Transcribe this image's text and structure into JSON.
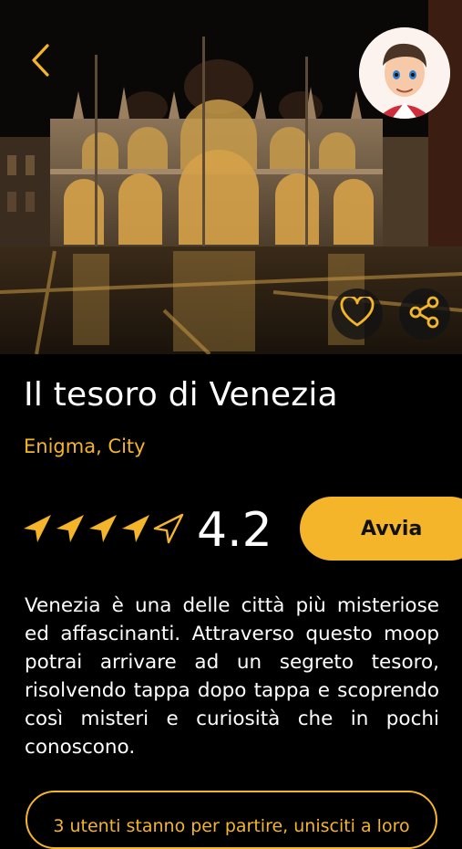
{
  "header": {
    "back_icon": "chevron-left-icon",
    "avatar_icon": "user-avatar"
  },
  "hero": {
    "favorite_icon": "heart-icon",
    "share_icon": "share-icon"
  },
  "experience": {
    "title": "Il tesoro di Venezia",
    "categories": "Enigma, City",
    "rating": "4.2",
    "rating_value": 4.2,
    "rating_max": 5,
    "start_label": "Avvia",
    "description": "Venezia è una delle città più misteriose ed affascinanti. Attraverso questo moop potrai arrivare ad un segreto  tesoro, risolvendo tappa dopo tappa e scoprendo così misteri e curiosità che in pochi conoscono.",
    "join_label": "3 utenti stanno per partire, unisciti a loro"
  },
  "colors": {
    "accent": "#f5b52b",
    "background": "#000000",
    "text": "#ffffff"
  }
}
